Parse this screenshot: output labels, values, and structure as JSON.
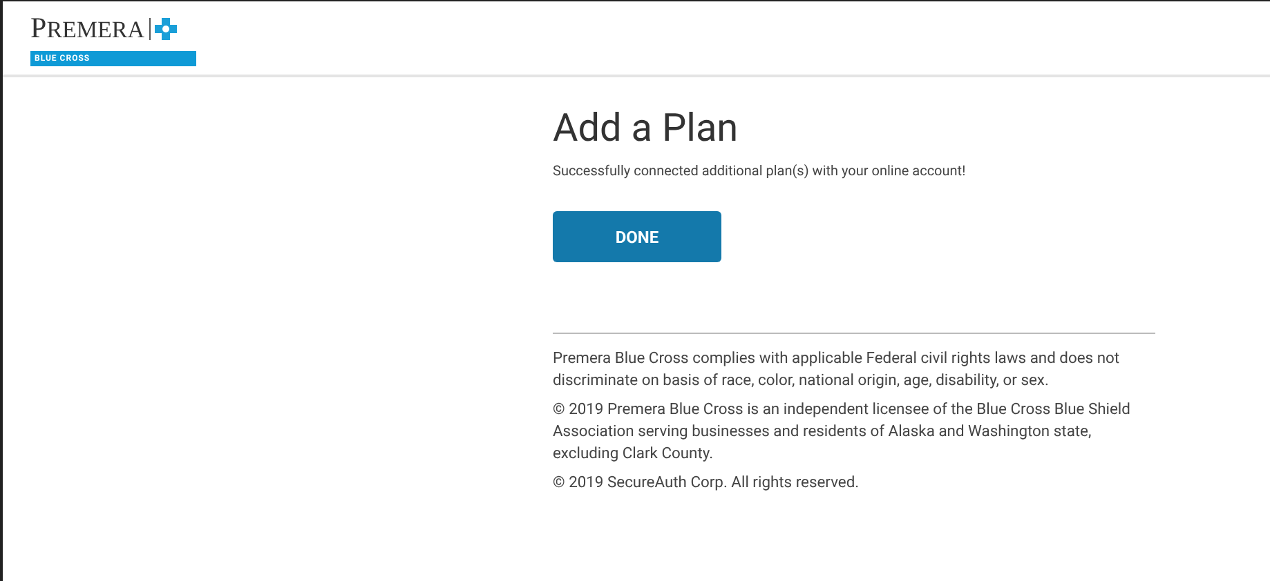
{
  "header": {
    "logo": {
      "wordmark": "PREMERA",
      "tagline": "BLUE CROSS"
    }
  },
  "main": {
    "title": "Add a Plan",
    "message": "Successfully connected additional plan(s) with your online account!",
    "button": "DONE"
  },
  "footer": {
    "paragraphs": [
      "Premera Blue Cross complies with applicable Federal civil rights laws and does not discriminate on basis of race, color, national origin, age, disability, or sex.",
      "© 2019 Premera Blue Cross is an independent licensee of the Blue Cross Blue Shield Association serving businesses and residents of Alaska and Washington state, excluding Clark County.",
      "© 2019 SecureAuth Corp. All rights reserved."
    ]
  }
}
